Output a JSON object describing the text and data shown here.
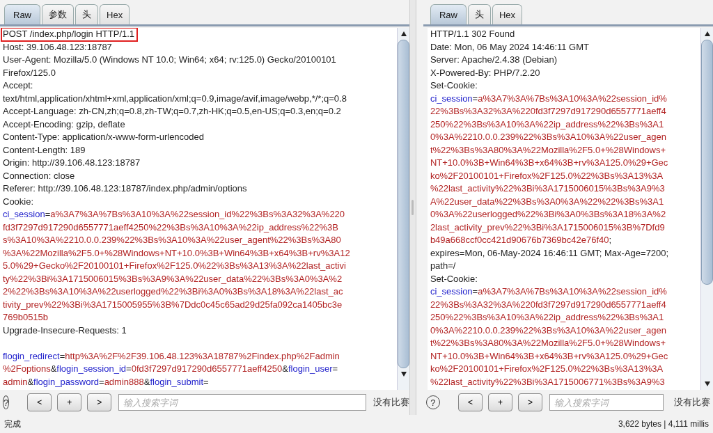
{
  "panes": [
    {
      "tabs": [
        {
          "label": "Raw",
          "selected": true
        },
        {
          "label": "参数",
          "selected": false
        },
        {
          "label": "头",
          "selected": false
        },
        {
          "label": "Hex",
          "selected": false
        }
      ],
      "lines": [
        {
          "kind": "text",
          "boxed": true,
          "parts": [
            {
              "kind": "plain",
              "text": "POST /index.php/login HTTP/1.1"
            }
          ]
        },
        {
          "kind": "text",
          "parts": [
            {
              "kind": "plain",
              "text": "Host: 39.106.48.123:18787"
            }
          ]
        },
        {
          "kind": "text",
          "parts": [
            {
              "kind": "plain",
              "text": "User-Agent: Mozilla/5.0 (Windows NT 10.0; Win64; x64; rv:125.0) Gecko/20100101"
            }
          ]
        },
        {
          "kind": "text",
          "parts": [
            {
              "kind": "plain",
              "text": "Firefox/125.0"
            }
          ]
        },
        {
          "kind": "text",
          "parts": [
            {
              "kind": "plain",
              "text": "Accept:"
            }
          ]
        },
        {
          "kind": "text",
          "parts": [
            {
              "kind": "plain",
              "text": "text/html,application/xhtml+xml,application/xml;q=0.9,image/avif,image/webp,*/*;q=0.8"
            }
          ]
        },
        {
          "kind": "text",
          "parts": [
            {
              "kind": "plain",
              "text": "Accept-Language: zh-CN,zh;q=0.8,zh-TW;q=0.7,zh-HK;q=0.5,en-US;q=0.3,en;q=0.2"
            }
          ]
        },
        {
          "kind": "text",
          "parts": [
            {
              "kind": "plain",
              "text": "Accept-Encoding: gzip, deflate"
            }
          ]
        },
        {
          "kind": "text",
          "parts": [
            {
              "kind": "plain",
              "text": "Content-Type: application/x-www-form-urlencoded"
            }
          ]
        },
        {
          "kind": "text",
          "parts": [
            {
              "kind": "plain",
              "text": "Content-Length: 189"
            }
          ]
        },
        {
          "kind": "text",
          "parts": [
            {
              "kind": "plain",
              "text": "Origin: http://39.106.48.123:18787"
            }
          ]
        },
        {
          "kind": "text",
          "parts": [
            {
              "kind": "plain",
              "text": "Connection: close"
            }
          ]
        },
        {
          "kind": "text",
          "parts": [
            {
              "kind": "plain",
              "text": "Referer: http://39.106.48.123:18787/index.php/admin/options"
            }
          ]
        },
        {
          "kind": "text",
          "parts": [
            {
              "kind": "plain",
              "text": "Cookie:"
            }
          ]
        },
        {
          "kind": "text",
          "parts": [
            {
              "kind": "name",
              "text": "ci_session"
            },
            {
              "kind": "plain",
              "text": "="
            },
            {
              "kind": "value",
              "text": "a%3A7%3A%7Bs%3A10%3A%22session_id%22%3Bs%3A32%3A%220"
            }
          ]
        },
        {
          "kind": "text",
          "parts": [
            {
              "kind": "value",
              "text": "fd3f7297d917290d6557771aeff4250%22%3Bs%3A10%3A%22ip_address%22%3B"
            }
          ]
        },
        {
          "kind": "text",
          "parts": [
            {
              "kind": "value",
              "text": "s%3A10%3A%2210.0.0.239%22%3Bs%3A10%3A%22user_agent%22%3Bs%3A80"
            }
          ]
        },
        {
          "kind": "text",
          "parts": [
            {
              "kind": "value",
              "text": "%3A%22Mozilla%2F5.0+%28Windows+NT+10.0%3B+Win64%3B+x64%3B+rv%3A12"
            }
          ]
        },
        {
          "kind": "text",
          "parts": [
            {
              "kind": "value",
              "text": "5.0%29+Gecko%2F20100101+Firefox%2F125.0%22%3Bs%3A13%3A%22last_activi"
            }
          ]
        },
        {
          "kind": "text",
          "parts": [
            {
              "kind": "value",
              "text": "ty%22%3Bi%3A1715006015%3Bs%3A9%3A%22user_data%22%3Bs%3A0%3A%2"
            }
          ]
        },
        {
          "kind": "text",
          "parts": [
            {
              "kind": "value",
              "text": "2%22%3Bs%3A10%3A%22userlogged%22%3Bi%3A0%3Bs%3A18%3A%22last_ac"
            }
          ]
        },
        {
          "kind": "text",
          "parts": [
            {
              "kind": "value",
              "text": "tivity_prev%22%3Bi%3A1715005955%3B%7Ddc0c45c65ad29d25fa092ca1405bc3e"
            }
          ]
        },
        {
          "kind": "text",
          "parts": [
            {
              "kind": "value",
              "text": "769b0515b"
            }
          ]
        },
        {
          "kind": "text",
          "parts": [
            {
              "kind": "plain",
              "text": "Upgrade-Insecure-Requests: 1"
            }
          ]
        },
        {
          "kind": "blank"
        },
        {
          "kind": "text",
          "parts": [
            {
              "kind": "name",
              "text": "flogin_redirect"
            },
            {
              "kind": "plain",
              "text": "="
            },
            {
              "kind": "value",
              "text": "http%3A%2F%2F39.106.48.123%3A18787%2Findex.php%2Fadmin"
            }
          ]
        },
        {
          "kind": "text",
          "parts": [
            {
              "kind": "value",
              "text": "%2Foptions"
            },
            {
              "kind": "plain",
              "text": "&"
            },
            {
              "kind": "name",
              "text": "flogin_session_id"
            },
            {
              "kind": "plain",
              "text": "="
            },
            {
              "kind": "value",
              "text": "0fd3f7297d917290d6557771aeff4250"
            },
            {
              "kind": "plain",
              "text": "&"
            },
            {
              "kind": "name",
              "text": "flogin_user"
            },
            {
              "kind": "plain",
              "text": "="
            }
          ]
        },
        {
          "kind": "text",
          "parts": [
            {
              "kind": "value",
              "text": "admin"
            },
            {
              "kind": "plain",
              "text": "&"
            },
            {
              "kind": "name",
              "text": "flogin_password"
            },
            {
              "kind": "plain",
              "text": "="
            },
            {
              "kind": "value",
              "text": "admin888"
            },
            {
              "kind": "plain",
              "text": "&"
            },
            {
              "kind": "name",
              "text": "flogin_submit"
            },
            {
              "kind": "plain",
              "text": "="
            }
          ]
        }
      ],
      "help": "?",
      "nav_buttons": [
        "<",
        "+",
        ">"
      ],
      "search": {
        "placeholder": "输入搜索字词"
      },
      "match_status": "没有比赛"
    },
    {
      "tabs": [
        {
          "label": "Raw",
          "selected": true
        },
        {
          "label": "头",
          "selected": false
        },
        {
          "label": "Hex",
          "selected": false
        }
      ],
      "lines": [
        {
          "kind": "text",
          "parts": [
            {
              "kind": "plain",
              "text": "HTTP/1.1 302 Found"
            }
          ]
        },
        {
          "kind": "text",
          "parts": [
            {
              "kind": "plain",
              "text": "Date: Mon, 06 May 2024 14:46:11 GMT"
            }
          ]
        },
        {
          "kind": "text",
          "parts": [
            {
              "kind": "plain",
              "text": "Server: Apache/2.4.38 (Debian)"
            }
          ]
        },
        {
          "kind": "text",
          "parts": [
            {
              "kind": "plain",
              "text": "X-Powered-By: PHP/7.2.20"
            }
          ]
        },
        {
          "kind": "text",
          "parts": [
            {
              "kind": "plain",
              "text": "Set-Cookie:"
            }
          ]
        },
        {
          "kind": "text",
          "parts": [
            {
              "kind": "name",
              "text": "ci_session"
            },
            {
              "kind": "plain",
              "text": "="
            },
            {
              "kind": "value",
              "text": "a%3A7%3A%7Bs%3A10%3A%22session_id%"
            }
          ]
        },
        {
          "kind": "text",
          "parts": [
            {
              "kind": "value",
              "text": "22%3Bs%3A32%3A%220fd3f7297d917290d6557771aeff4"
            }
          ]
        },
        {
          "kind": "text",
          "parts": [
            {
              "kind": "value",
              "text": "250%22%3Bs%3A10%3A%22ip_address%22%3Bs%3A1"
            }
          ]
        },
        {
          "kind": "text",
          "parts": [
            {
              "kind": "value",
              "text": "0%3A%2210.0.0.239%22%3Bs%3A10%3A%22user_agen"
            }
          ]
        },
        {
          "kind": "text",
          "parts": [
            {
              "kind": "value",
              "text": "t%22%3Bs%3A80%3A%22Mozilla%2F5.0+%28Windows+"
            }
          ]
        },
        {
          "kind": "text",
          "parts": [
            {
              "kind": "value",
              "text": "NT+10.0%3B+Win64%3B+x64%3B+rv%3A125.0%29+Gec"
            }
          ]
        },
        {
          "kind": "text",
          "parts": [
            {
              "kind": "value",
              "text": "ko%2F20100101+Firefox%2F125.0%22%3Bs%3A13%3A"
            }
          ]
        },
        {
          "kind": "text",
          "parts": [
            {
              "kind": "value",
              "text": "%22last_activity%22%3Bi%3A1715006015%3Bs%3A9%3"
            }
          ]
        },
        {
          "kind": "text",
          "parts": [
            {
              "kind": "value",
              "text": "A%22user_data%22%3Bs%3A0%3A%22%22%3Bs%3A1"
            }
          ]
        },
        {
          "kind": "text",
          "parts": [
            {
              "kind": "value",
              "text": "0%3A%22userlogged%22%3Bi%3A0%3Bs%3A18%3A%2"
            }
          ]
        },
        {
          "kind": "text",
          "parts": [
            {
              "kind": "value",
              "text": "2last_activity_prev%22%3Bi%3A1715006015%3B%7Dfd9"
            }
          ]
        },
        {
          "kind": "text",
          "parts": [
            {
              "kind": "value",
              "text": "b49a668ccf0cc421d90676b7369bc42e76f40"
            },
            {
              "kind": "plain",
              "text": ";"
            }
          ]
        },
        {
          "kind": "text",
          "parts": [
            {
              "kind": "plain",
              "text": "expires=Mon, 06-May-2024 16:46:11 GMT; Max-Age=7200;"
            }
          ]
        },
        {
          "kind": "text",
          "parts": [
            {
              "kind": "plain",
              "text": "path=/"
            }
          ]
        },
        {
          "kind": "text",
          "parts": [
            {
              "kind": "plain",
              "text": "Set-Cookie:"
            }
          ]
        },
        {
          "kind": "text",
          "parts": [
            {
              "kind": "name",
              "text": "ci_session"
            },
            {
              "kind": "plain",
              "text": "="
            },
            {
              "kind": "value",
              "text": "a%3A7%3A%7Bs%3A10%3A%22session_id%"
            }
          ]
        },
        {
          "kind": "text",
          "parts": [
            {
              "kind": "value",
              "text": "22%3Bs%3A32%3A%220fd3f7297d917290d6557771aeff4"
            }
          ]
        },
        {
          "kind": "text",
          "parts": [
            {
              "kind": "value",
              "text": "250%22%3Bs%3A10%3A%22ip_address%22%3Bs%3A1"
            }
          ]
        },
        {
          "kind": "text",
          "parts": [
            {
              "kind": "value",
              "text": "0%3A%2210.0.0.239%22%3Bs%3A10%3A%22user_agen"
            }
          ]
        },
        {
          "kind": "text",
          "parts": [
            {
              "kind": "value",
              "text": "t%22%3Bs%3A80%3A%22Mozilla%2F5.0+%28Windows+"
            }
          ]
        },
        {
          "kind": "text",
          "parts": [
            {
              "kind": "value",
              "text": "NT+10.0%3B+Win64%3B+x64%3B+rv%3A125.0%29+Gec"
            }
          ]
        },
        {
          "kind": "text",
          "parts": [
            {
              "kind": "value",
              "text": "ko%2F20100101+Firefox%2F125.0%22%3Bs%3A13%3A"
            }
          ]
        },
        {
          "kind": "text",
          "parts": [
            {
              "kind": "value",
              "text": "%22last_activity%22%3Bi%3A1715006771%3Bs%3A9%3"
            }
          ]
        }
      ],
      "help": "?",
      "nav_buttons": [
        "<",
        "+",
        ">"
      ],
      "search": {
        "placeholder": "输入搜索字词"
      },
      "match_status": "没有比赛"
    }
  ],
  "status_bar": {
    "left": "完成",
    "right": "3,622 bytes | 4,111 millis"
  }
}
